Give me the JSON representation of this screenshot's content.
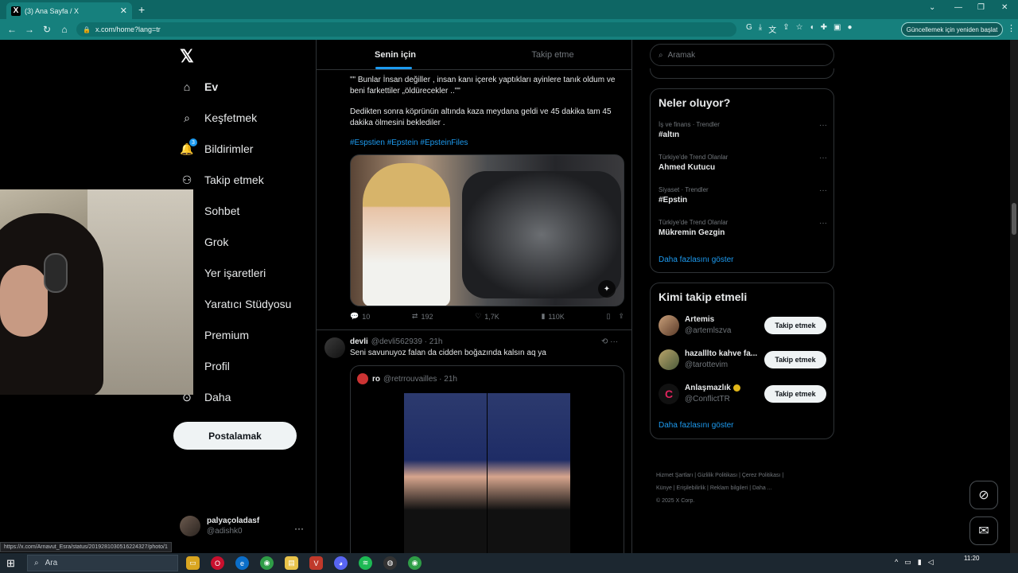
{
  "browser": {
    "tab_title": "(3) Ana Sayfa / X",
    "tab_close": "✕",
    "new_tab": "+",
    "url": "x.com/home?lang=tr",
    "update_button": "Güncellemek için yeniden başlat",
    "window_controls": [
      "⌄",
      "—",
      "❐",
      "✕"
    ]
  },
  "nav": {
    "items": [
      {
        "label": "Ev",
        "icon": "home-icon"
      },
      {
        "label": "Keşfetmek",
        "icon": "search-icon"
      },
      {
        "label": "Bildirimler",
        "icon": "bell-icon",
        "badge": "3"
      },
      {
        "label": "Takip etmek",
        "icon": "person-add-icon"
      },
      {
        "label": "Sohbet",
        "icon": "chat-icon"
      },
      {
        "label": "Grok",
        "icon": "grok-icon"
      },
      {
        "label": "Yer işaretleri",
        "icon": "bookmark-icon"
      },
      {
        "label": "Yaratıcı Stüdyosu",
        "icon": "studio-icon"
      },
      {
        "label": "Premium",
        "icon": "x-icon"
      },
      {
        "label": "Profil",
        "icon": "person-icon"
      },
      {
        "label": "Daha",
        "icon": "more-icon"
      }
    ],
    "post_button": "Postalamak",
    "account": {
      "name": "palyaçoladasf",
      "handle": "@adishk0"
    }
  },
  "feed": {
    "tabs": [
      "Senin için",
      "Takip etme"
    ],
    "tweet1": {
      "text_1": "\"\" Bunlar İnsan değiller , insan kanı içerek yaptıkları ayinlere tanık oldum ve beni farkettiler „öldürecekler ..\"\"",
      "text_2": "Dedikten sonra köprünün altında kaza meydana geldi ve 45 dakika tam 45 dakika ölmesini beklediler .",
      "hashtags": "#Espstien #Epstein #EpsteinFiles",
      "replies": "10",
      "reposts": "192",
      "likes": "1,7K",
      "views": "110K"
    },
    "tweet2": {
      "name": "devli",
      "handle_time": "@devli562939 · 21h",
      "text": "Seni savunuyoz falan da cidden boğazında kalsın aq ya",
      "quote_name": "ro",
      "quote_handle_time": "@retrrouvailles · 21h"
    }
  },
  "right": {
    "search_placeholder": "Aramak",
    "trends_title": "Neler oluyor?",
    "trends": [
      {
        "category": "İş ve finans · Trendler",
        "name": "#altın"
      },
      {
        "category": "Türkiye'de Trend Olanlar",
        "name": "Ahmed Kutucu"
      },
      {
        "category": "Siyaset · Trendler",
        "name": "#Epstin"
      },
      {
        "category": "Türkiye'de Trend Olanlar",
        "name": "Mükremin Gezgin"
      }
    ],
    "show_more": "Daha fazlasını göster",
    "who_title": "Kimi takip etmeli",
    "who": [
      {
        "name": "Artemis",
        "handle": "@artemlszva",
        "button": "Takip etmek"
      },
      {
        "name": "hazalllto kahve fa...",
        "handle": "@tarottevim",
        "button": "Takip etmek"
      },
      {
        "name": "Anlaşmazlık",
        "handle": "@ConflictTR",
        "button": "Takip etmek"
      }
    ],
    "footer_line1": "Hizmet Şartları | Gizlilik Politikası | Çerez Politikası |",
    "footer_line2": "Künye | Erişilebilirlik | Reklam bilgileri | Daha ...",
    "footer_line3": "© 2025 X Corp."
  },
  "status_url": "https://x.com/Arnavut_Esra/status/2019281030516224327/photo/1",
  "taskbar": {
    "search_label": "Ara",
    "time": "11:20"
  }
}
